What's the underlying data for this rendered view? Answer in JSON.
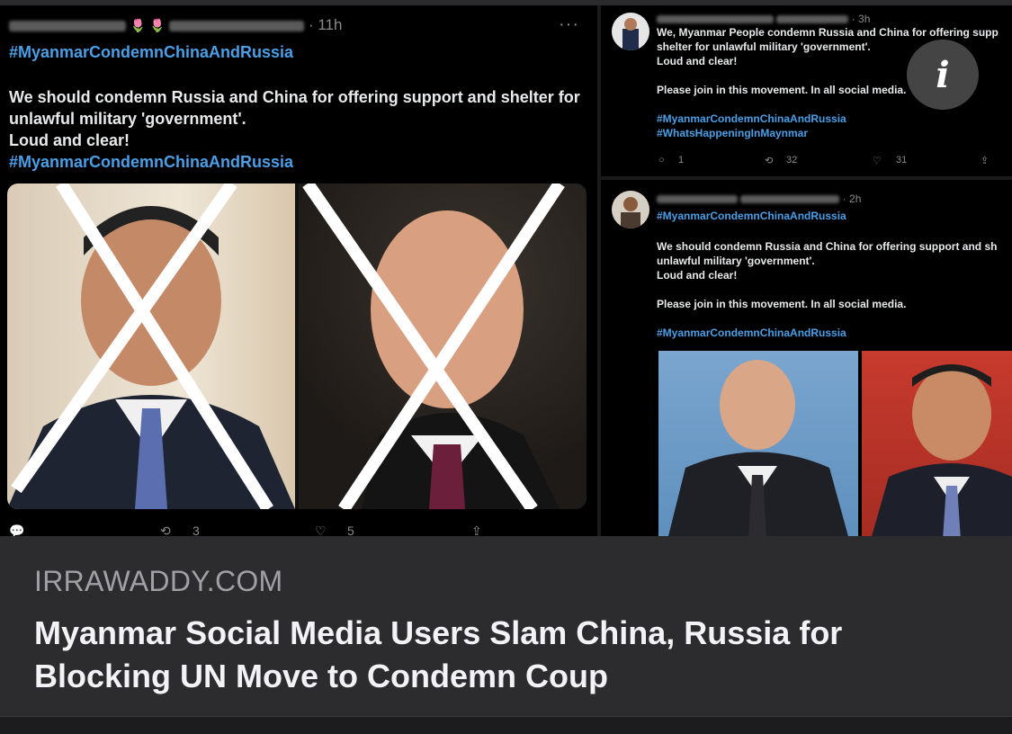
{
  "main_tweet": {
    "time": "· 11h",
    "hashtag": "#MyanmarCondemnChinaAndRussia",
    "text_lines": [
      "We should condemn Russia and China for offering support and shelter for",
      "unlawful military 'government'.",
      "Loud and clear!"
    ],
    "hashtag2": "#MyanmarCondemnChinaAndRussia",
    "more": "···",
    "actions": {
      "retweets": "3",
      "likes": "5"
    }
  },
  "tweet_top_right": {
    "time": "· 3h",
    "lines": [
      "We, Myanmar People condemn Russia and China for offering supp",
      "shelter for unlawful military 'government'.",
      "Loud and clear!"
    ],
    "line_join": "Please join in this movement. In all social media.",
    "hashtags": [
      "#MyanmarCondemnChinaAndRussia",
      "#WhatsHappeningInMaynmar"
    ],
    "actions": {
      "replies": "1",
      "retweets": "32",
      "likes": "31"
    }
  },
  "tweet_bottom_right": {
    "time": "· 2h",
    "hashtag": "#MyanmarCondemnChinaAndRussia",
    "lines": [
      "We should condemn Russia and China for offering support and sh",
      "unlawful military 'government'.",
      "Loud and clear!"
    ],
    "line_join": "Please join in this movement. In all social media.",
    "hashtag2": "#MyanmarCondemnChinaAndRussia"
  },
  "info_button": {
    "label": "i"
  },
  "article": {
    "source": "IRRAWADDY.COM",
    "headline_lines": [
      "Myanmar Social Media Users Slam China, Russia for",
      "Blocking UN Move to Condemn Coup"
    ]
  }
}
